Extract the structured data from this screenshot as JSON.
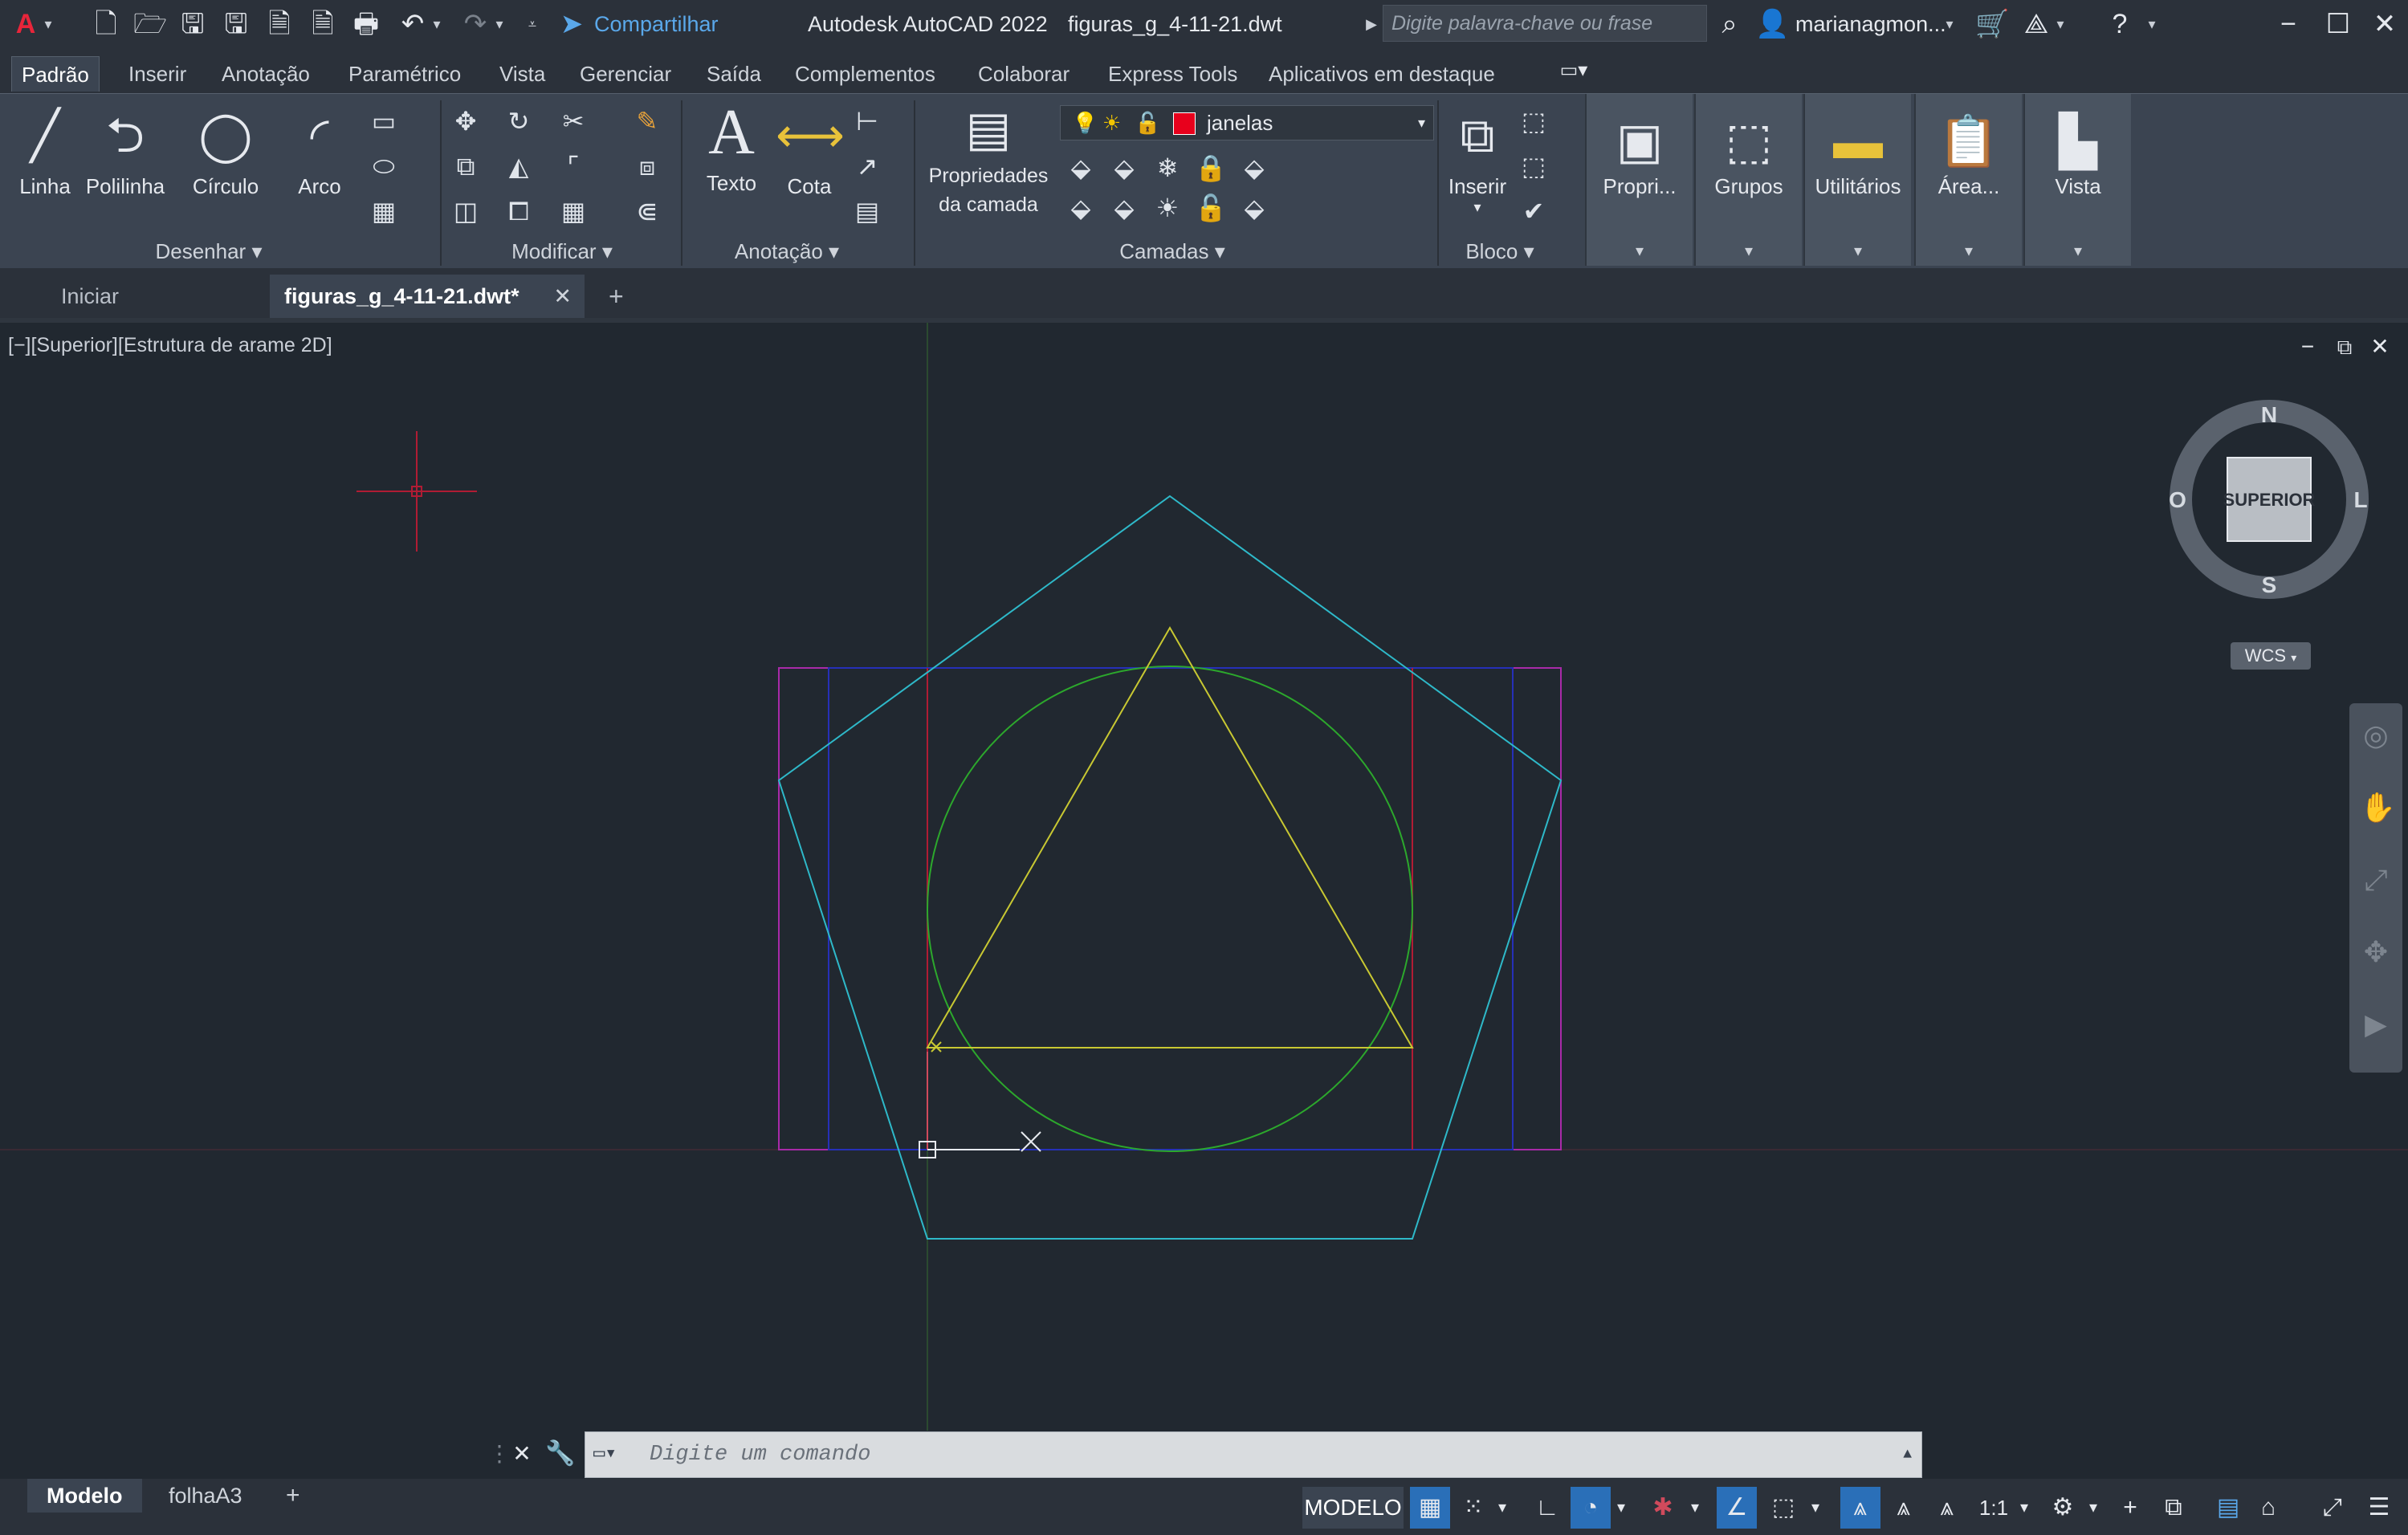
{
  "titlebar": {
    "app_icon": "autocad-logo-icon",
    "share_label": "Compartilhar",
    "app_title": "Autodesk AutoCAD 2022",
    "file_name": "figuras_g_4-11-21.dwt",
    "search_placeholder": "Digite palavra-chave ou frase",
    "user_name": "marianagmon..."
  },
  "ribbon_tabs": [
    "Padrão",
    "Inserir",
    "Anotação",
    "Paramétrico",
    "Vista",
    "Gerenciar",
    "Saída",
    "Complementos",
    "Colaborar",
    "Express Tools",
    "Aplicativos em destaque"
  ],
  "ribbon": {
    "draw": {
      "title": "Desenhar",
      "tools": [
        "Linha",
        "Polilinha",
        "Círculo",
        "Arco"
      ]
    },
    "modify": {
      "title": "Modificar"
    },
    "annotation": {
      "title": "Anotação",
      "tools": [
        "Texto",
        "Cota"
      ]
    },
    "layers": {
      "title": "Camadas",
      "props_label_1": "Propriedades",
      "props_label_2": "da camada",
      "current_layer": "janelas",
      "layer_color": "#e8001c"
    },
    "block": {
      "title": "Bloco",
      "insert_label": "Inserir"
    },
    "panels": [
      "Propri...",
      "Grupos",
      "Utilitários",
      "Área...",
      "Vista"
    ]
  },
  "file_tabs": {
    "start": "Iniciar",
    "active": "figuras_g_4-11-21.dwt*"
  },
  "viewport": {
    "label": "[−][Superior][Estrutura de arame 2D]",
    "viewcube": {
      "n": "N",
      "s": "S",
      "e": "L",
      "w": "O",
      "face": "SUPERIOR"
    },
    "ucs": "WCS"
  },
  "command": {
    "placeholder": "Digite um comando"
  },
  "status": {
    "layout_tabs": [
      "Modelo",
      "folhaA3"
    ],
    "model_label": "MODELO",
    "scale": "1:1"
  },
  "colors": {
    "background": "#212830",
    "pentagon": "#2eb9c9",
    "circle": "#2ca82c",
    "triangle": "#c8c832",
    "magenta_rect": "#a82aa8",
    "blue_rect": "#2630b8",
    "red_lines": "#b01c34"
  }
}
